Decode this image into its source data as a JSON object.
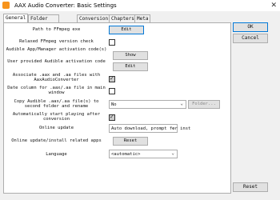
{
  "window": {
    "title": "AAX Audio Converter: Basic Settings",
    "close_glyph": "✕"
  },
  "tabs": [
    {
      "label": "General",
      "active": true
    },
    {
      "label": "Folder structure"
    },
    {
      "label": "Conversion"
    },
    {
      "label": "Chapters"
    },
    {
      "label": "Meta tags"
    }
  ],
  "settings": {
    "ffmpeg_path": {
      "label": "Path to FFmpeg exe",
      "button": "Edit"
    },
    "relaxed_ffmpeg": {
      "label": "Relaxed FFmpeg version check",
      "checked": false
    },
    "audible_activation": {
      "label": "Audible App/Manager activation code(s)",
      "button": "Show"
    },
    "user_activation": {
      "label": "User provided Audible activation code",
      "button": "Edit"
    },
    "associate": {
      "label": "Associate .aax and .aa files with AaxAudioConverter",
      "checked": true
    },
    "date_column": {
      "label": "Date column for .aax/.aa file in main window",
      "checked": false
    },
    "copy_files": {
      "label": "Copy Audible .aax/.aa file(s) to second folder and rename",
      "value": "No",
      "button": "Folder..."
    },
    "autostart": {
      "label": "Automatically start playing after conversion",
      "checked": true
    },
    "online_update": {
      "label": "Online update",
      "value": "Auto download, prompt for inst"
    },
    "online_update_apps": {
      "label": "Online update/install related apps",
      "button": "Reset"
    },
    "language": {
      "label": "Language",
      "value": "<automatic>"
    }
  },
  "side_buttons": {
    "ok": "OK",
    "cancel": "Cancel",
    "reset": "Reset"
  },
  "colors": {
    "focus": "#0078d7",
    "icon": "#f7941d"
  }
}
